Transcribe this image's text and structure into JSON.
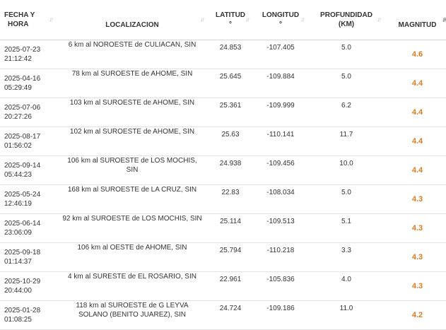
{
  "table": {
    "headers": {
      "date": [
        "FECHA Y",
        "HORA"
      ],
      "location": "LOCALIZACION",
      "latitude": [
        "LATITUD",
        "°"
      ],
      "longitude": [
        "LONGITUD",
        "°"
      ],
      "depth": [
        "PROFUNDIDAD",
        "(KM)"
      ],
      "magnitude": "MAGNITUD"
    },
    "rows": [
      {
        "date": "2025-07-23",
        "time": "21:12:42",
        "location": "6 km al NOROESTE de CULIACAN, SIN",
        "lat": "24.853",
        "lon": "-107.405",
        "depth": "5.0",
        "mag": "4.6"
      },
      {
        "date": "2025-04-16",
        "time": "05:29:49",
        "location": "78 km al SUROESTE de AHOME, SIN",
        "lat": "25.645",
        "lon": "-109.884",
        "depth": "5.0",
        "mag": "4.4"
      },
      {
        "date": "2025-07-06",
        "time": "20:27:26",
        "location": "103 km al SUROESTE de AHOME, SIN",
        "lat": "25.361",
        "lon": "-109.999",
        "depth": "6.2",
        "mag": "4.4"
      },
      {
        "date": "2025-08-17",
        "time": "01:56:02",
        "location": "102 km al SUROESTE de AHOME, SIN",
        "lat": "25.63",
        "lon": "-110.141",
        "depth": "11.7",
        "mag": "4.4"
      },
      {
        "date": "2025-09-14",
        "time": "05:44:23",
        "location": "106 km al SUROESTE de LOS MOCHIS, SIN",
        "lat": "24.938",
        "lon": "-109.456",
        "depth": "10.0",
        "mag": "4.4"
      },
      {
        "date": "2025-05-24",
        "time": "12:46:19",
        "location": "168 km al SUROESTE de LA CRUZ, SIN",
        "lat": "22.83",
        "lon": "-108.034",
        "depth": "5.0",
        "mag": "4.3"
      },
      {
        "date": "2025-06-14",
        "time": "23:06:09",
        "location": "92 km al SUROESTE de LOS MOCHIS, SIN",
        "lat": "25.114",
        "lon": "-109.513",
        "depth": "5.1",
        "mag": "4.3"
      },
      {
        "date": "2025-09-18",
        "time": "01:14:37",
        "location": "106 km al OESTE de AHOME, SIN",
        "lat": "25.794",
        "lon": "-110.218",
        "depth": "3.3",
        "mag": "4.3"
      },
      {
        "date": "2025-10-29",
        "time": "20:44:00",
        "location": "4 km al SURESTE de EL ROSARIO, SIN",
        "lat": "22.961",
        "lon": "-105.836",
        "depth": "4.0",
        "mag": "4.3"
      },
      {
        "date": "2025-01-28",
        "time": "01:08:25",
        "location": "118 km al SUROESTE de G LEYVA SOLANO (BENITO JUAREZ), SIN",
        "lat": "24.724",
        "lon": "-109.186",
        "depth": "11.0",
        "mag": "4.2"
      }
    ]
  },
  "colors": {
    "magnitude": "#e07b1f",
    "header_border": "#d4d4d4",
    "row_border": "#e2e2e2"
  },
  "icons": {
    "sort_inactive": "sort-arrows-icon",
    "sort_active": "sort-descending-icon"
  }
}
